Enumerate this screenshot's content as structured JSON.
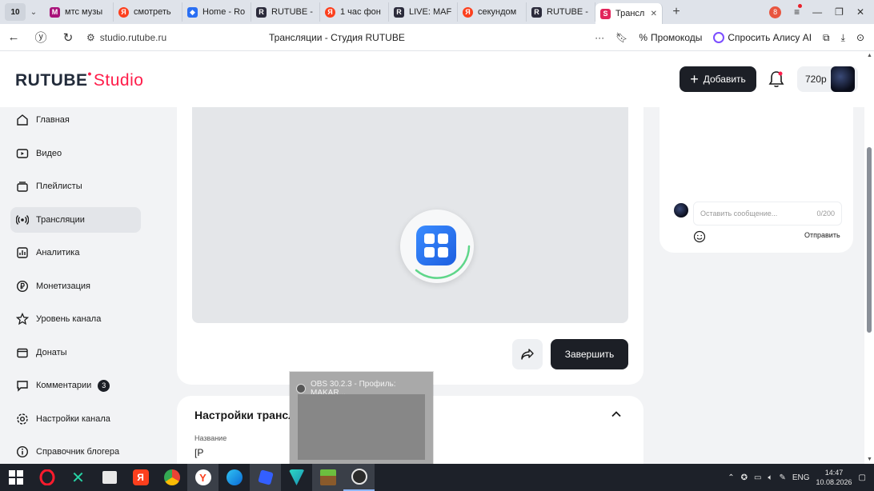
{
  "browser": {
    "tab_count": "10",
    "tabs": [
      {
        "label": "мтс музы",
        "icon": "mts-icon",
        "active": false
      },
      {
        "label": "смотреть",
        "icon": "yandex-icon",
        "active": false
      },
      {
        "label": "Home - Ro",
        "icon": "roblox-icon",
        "active": false
      },
      {
        "label": "RUTUBE -",
        "icon": "rutube-icon",
        "active": false
      },
      {
        "label": "1 час фон",
        "icon": "yandex-icon",
        "active": false
      },
      {
        "label": "LIVE: MAF",
        "icon": "rutube-icon",
        "active": false
      },
      {
        "label": "секундом",
        "icon": "yandex-icon",
        "active": false
      },
      {
        "label": "RUTUBE -",
        "icon": "rutube-icon",
        "active": false
      },
      {
        "label": "Трансл",
        "icon": "studio-icon",
        "active": true
      }
    ],
    "notif_count": "8",
    "url": "studio.rutube.ru",
    "page_title": "Трансляции - Студия RUTUBE",
    "promo_label": "Промокоды",
    "alice_label": "Спросить Алису AI"
  },
  "header": {
    "logo_main": "RUTUBE",
    "logo_studio": "Studio",
    "add_label": "Добавить",
    "resolution": "720p"
  },
  "sidebar": {
    "items": [
      {
        "label": "Главная",
        "icon": "home-icon"
      },
      {
        "label": "Видео",
        "icon": "video-icon"
      },
      {
        "label": "Плейлисты",
        "icon": "playlist-icon"
      },
      {
        "label": "Трансляции",
        "icon": "broadcast-icon",
        "active": true
      },
      {
        "label": "Аналитика",
        "icon": "analytics-icon"
      },
      {
        "label": "Монетизация",
        "icon": "monetization-icon"
      },
      {
        "label": "Уровень канала",
        "icon": "star-icon"
      },
      {
        "label": "Донаты",
        "icon": "donate-icon"
      },
      {
        "label": "Комментарии",
        "icon": "comments-icon",
        "count": "3"
      },
      {
        "label": "Настройки канала",
        "icon": "settings-icon"
      },
      {
        "label": "Справочник блогера",
        "icon": "info-icon"
      }
    ]
  },
  "main": {
    "finish_label": "Завершить",
    "settings_title": "Настройки трансляции",
    "name_label": "Название",
    "name_value": "[P"
  },
  "chat": {
    "placeholder": "Оставить сообщение...",
    "counter": "0/200",
    "send_label": "Отправить"
  },
  "obs_popup": {
    "title": "OBS 30.2.3 - Профиль: MAKAR..."
  },
  "taskbar": {
    "language": "ENG",
    "time": "14:47",
    "date": "10.08.2026"
  },
  "colors": {
    "accent": "#ff1d4a",
    "dark_button": "#1c1f26",
    "page_bg": "#f2f3f5"
  }
}
